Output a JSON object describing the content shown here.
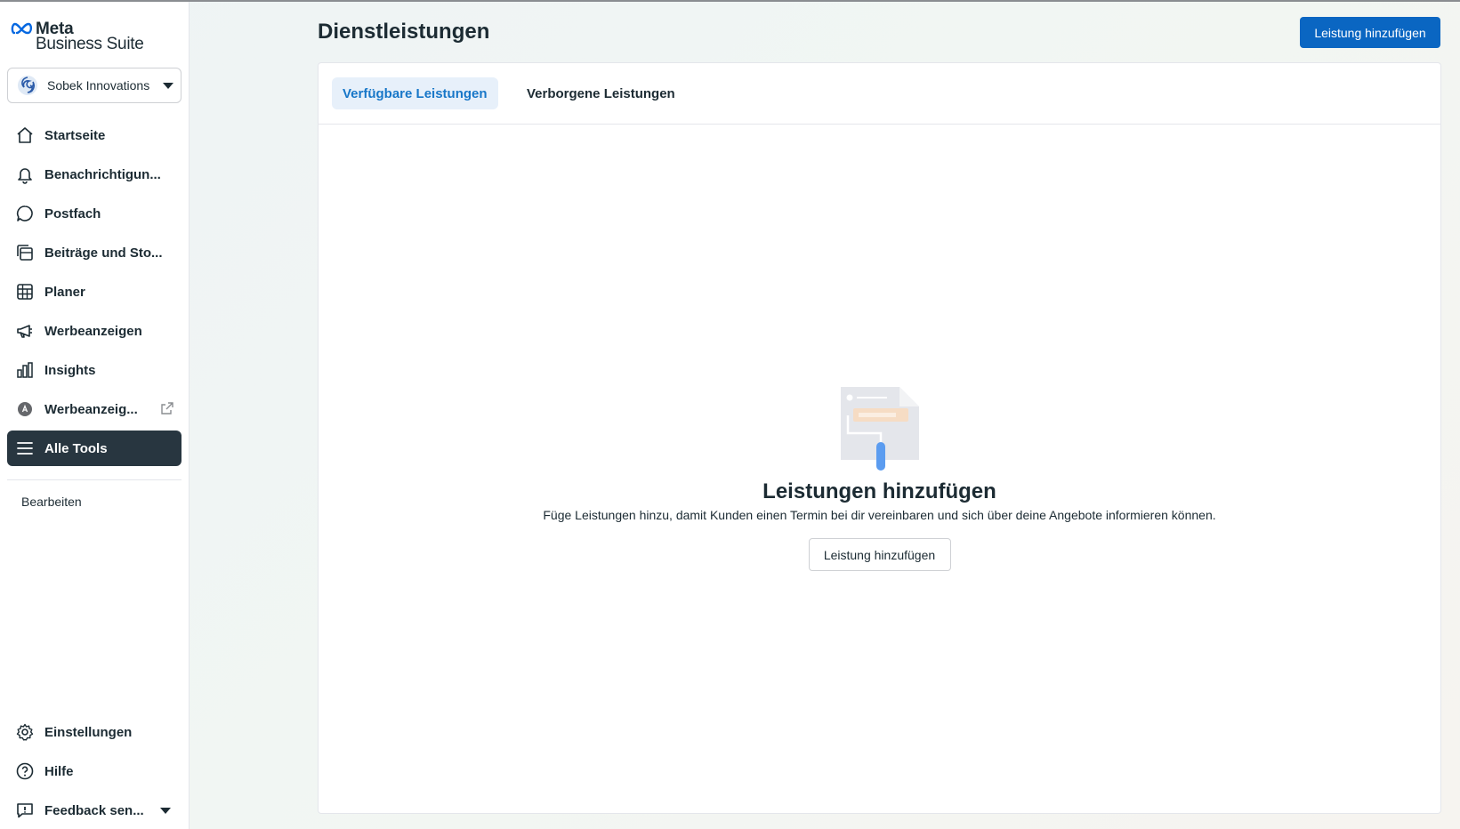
{
  "brand": {
    "line1": "Meta",
    "line2": "Business Suite"
  },
  "account": {
    "name": "Sobek Innovations"
  },
  "sidebar": {
    "items": [
      {
        "label": "Startseite",
        "icon": "home-icon"
      },
      {
        "label": "Benachrichtigun...",
        "icon": "bell-icon"
      },
      {
        "label": "Postfach",
        "icon": "chat-bubble-icon"
      },
      {
        "label": "Beiträge und Sto...",
        "icon": "posts-icon"
      },
      {
        "label": "Planer",
        "icon": "calendar-grid-icon"
      },
      {
        "label": "Werbeanzeigen",
        "icon": "megaphone-icon"
      },
      {
        "label": "Insights",
        "icon": "bar-chart-icon"
      },
      {
        "label": "Werbeanzeig...",
        "icon": "ads-manager-icon"
      },
      {
        "label": "Alle Tools",
        "icon": "menu-icon",
        "active": true
      }
    ],
    "edit_label": "Bearbeiten",
    "bottom_items": [
      {
        "label": "Einstellungen",
        "icon": "gear-icon"
      },
      {
        "label": "Hilfe",
        "icon": "help-icon"
      },
      {
        "label": "Feedback sen...",
        "icon": "feedback-icon"
      }
    ]
  },
  "header": {
    "title": "Dienstleistungen",
    "primary_action": "Leistung hinzufügen"
  },
  "tabs": [
    {
      "label": "Verfügbare Leistungen",
      "active": true
    },
    {
      "label": "Verborgene Leistungen",
      "active": false
    }
  ],
  "empty_state": {
    "title": "Leistungen hinzufügen",
    "description": "Füge Leistungen hinzu, damit Kunden einen Termin bei dir vereinbaren und sich über deine Angebote informieren können.",
    "button": "Leistung hinzufügen"
  },
  "colors": {
    "accent": "#0a66c2",
    "active_nav_bg": "#283640",
    "active_tab_bg": "#e7f0fa",
    "active_tab_text": "#1877c8"
  }
}
